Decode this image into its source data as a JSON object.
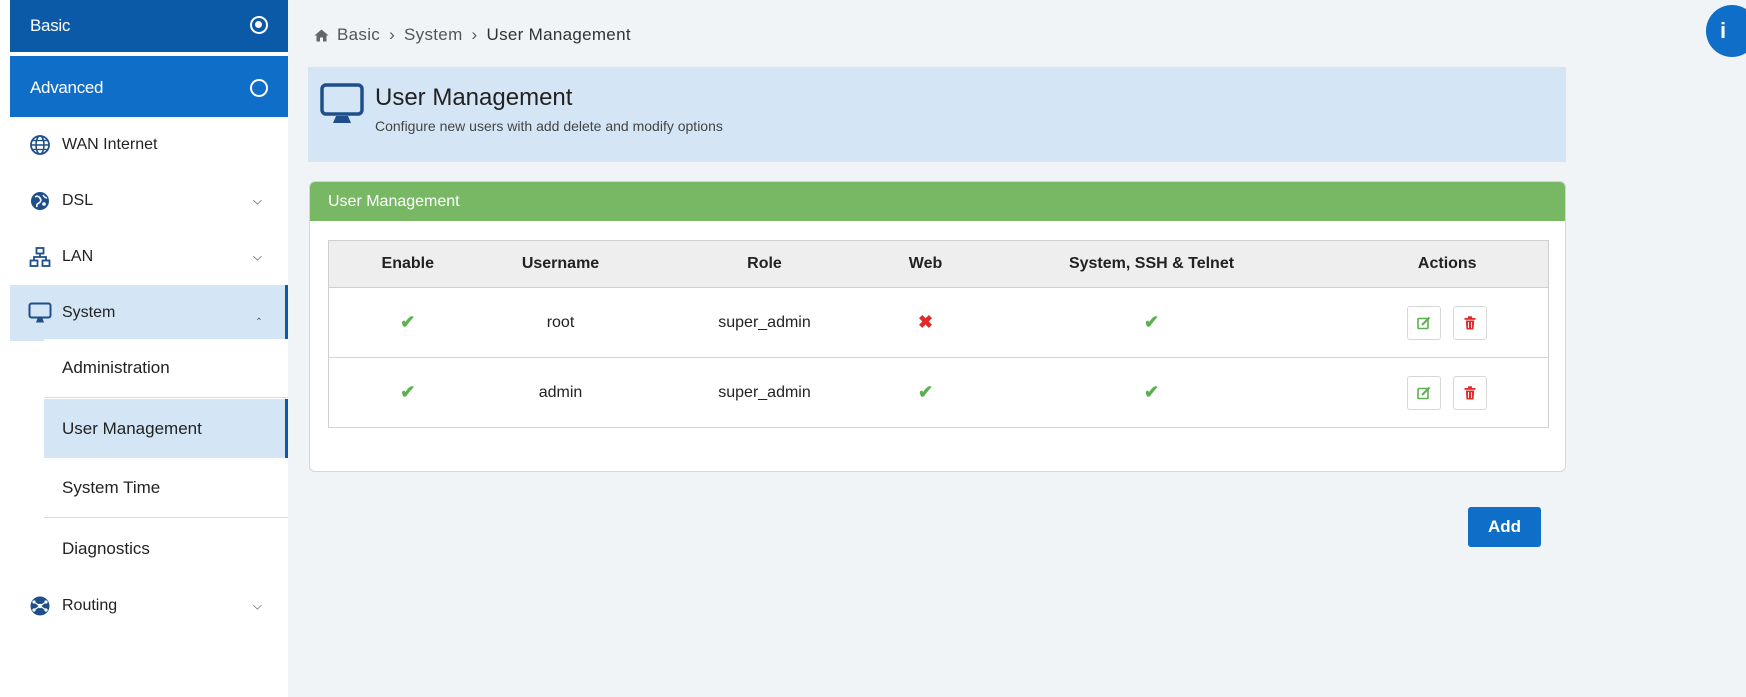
{
  "sidebar": {
    "basic_label": "Basic",
    "advanced_label": "Advanced",
    "items": [
      {
        "label": "WAN Internet",
        "icon": "globe-icon"
      },
      {
        "label": "DSL",
        "icon": "dsl-globe-icon"
      },
      {
        "label": "LAN",
        "icon": "network-icon"
      },
      {
        "label": "System",
        "icon": "monitor-icon"
      },
      {
        "label": "Routing",
        "icon": "routing-icon"
      }
    ],
    "system_sub": [
      {
        "label": "Administration"
      },
      {
        "label": "User Management"
      },
      {
        "label": "System Time"
      },
      {
        "label": "Diagnostics"
      }
    ]
  },
  "breadcrumb": {
    "items": [
      "Basic",
      "System",
      "User Management"
    ],
    "separator": "›"
  },
  "header": {
    "title": "User Management",
    "subtitle": "Configure new users with add delete and modify options"
  },
  "panel": {
    "title": "User Management",
    "columns": [
      "Enable",
      "Username",
      "Role",
      "Web",
      "System, SSH & Telnet",
      "Actions"
    ],
    "rows": [
      {
        "enable": true,
        "username": "root",
        "role": "super_admin",
        "web": false,
        "ssh": true
      },
      {
        "enable": true,
        "username": "admin",
        "role": "super_admin",
        "web": true,
        "ssh": true
      }
    ]
  },
  "actions": {
    "add_label": "Add"
  },
  "colors": {
    "primary": "#0e6ec8",
    "panel_header": "#78b865",
    "check": "#5cb050",
    "cross": "#e12a2a",
    "header_bg": "#d4e6f5"
  }
}
